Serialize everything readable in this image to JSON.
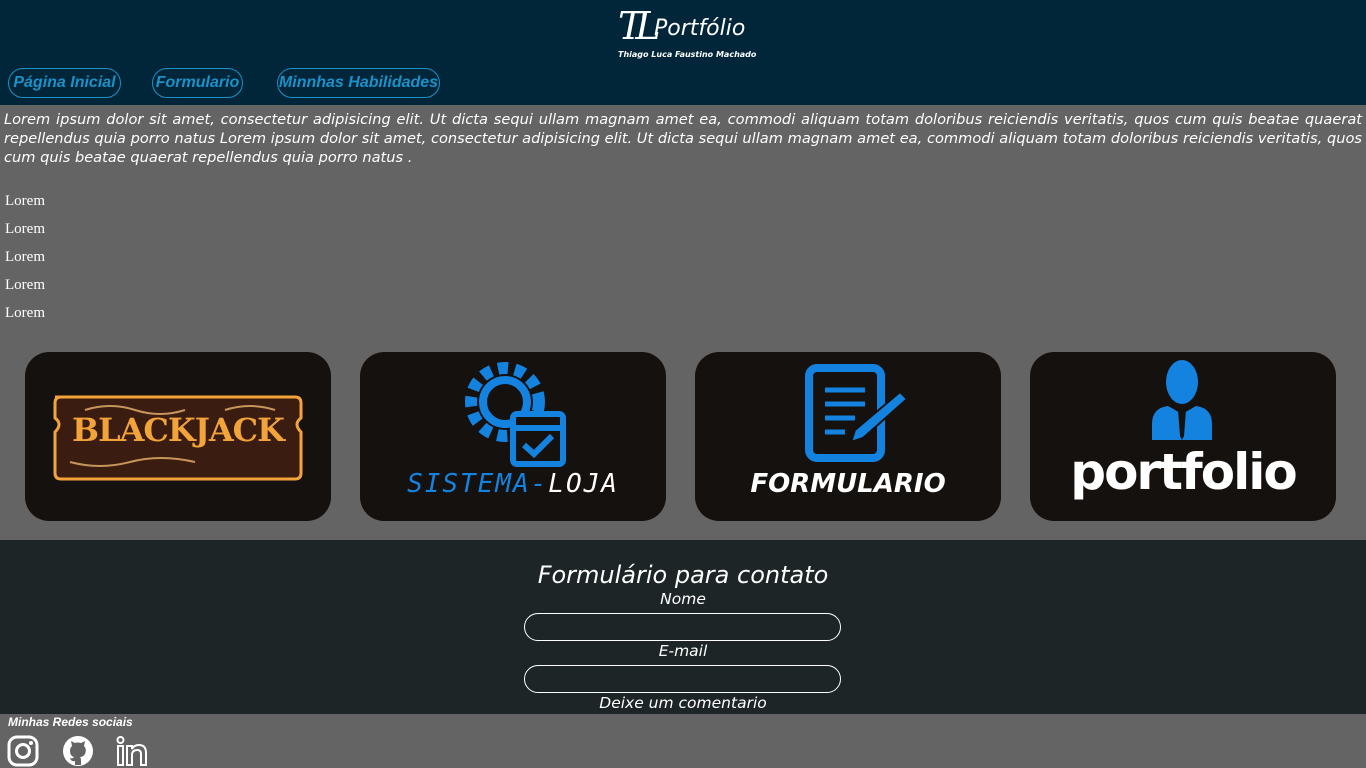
{
  "header": {
    "logo_monogram": "TL",
    "logo_word": "Portfólio",
    "logo_subtitle": "Thiago Luca Faustino Machado",
    "nav": [
      {
        "label": "Página Inicial"
      },
      {
        "label": "Formulario"
      },
      {
        "label": "Minnhas Habilidades"
      }
    ],
    "background_color": "#012539",
    "accent_color": "#1a92c9"
  },
  "intro": {
    "text": "Lorem ipsum dolor sit amet, consectetur adipisicing elit. Ut dicta sequi ullam magnam amet ea, commodi aliquam totam doloribus reiciendis veritatis, quos cum quis beatae quaerat repellendus quia porro natus Lorem ipsum dolor sit amet, consectetur adipisicing elit. Ut dicta sequi ullam magnam amet ea, commodi aliquam totam doloribus reiciendis veritatis, quos cum quis beatae quaerat repellendus quia porro natus .",
    "items": [
      "Lorem",
      "Lorem",
      "Lorem",
      "Lorem",
      "Lorem"
    ]
  },
  "projects": [
    {
      "title": "BLACKJACK",
      "icon": "blackjack-logo",
      "color": "#f2a33a"
    },
    {
      "title": "SISTEMA-LOJA",
      "title_part1": "SISTEMA-",
      "title_part2": "LOJA",
      "icon": "gear-checklist-icon",
      "color": "#1483e0"
    },
    {
      "title": "FORMULARIO",
      "icon": "document-pencil-icon",
      "color": "#1483e0"
    },
    {
      "title": "portfolio",
      "icon": "businessman-icon",
      "color": "#1483e0"
    }
  ],
  "contact": {
    "title": "Formulário para contato",
    "fields": [
      {
        "label": "Nome",
        "value": ""
      },
      {
        "label": "E-mail",
        "value": ""
      },
      {
        "label": "Deixe um comentario"
      }
    ],
    "background_color": "#1d2527"
  },
  "footer": {
    "social_title": "Minhas Redes sociais",
    "social": [
      {
        "icon": "instagram-icon"
      },
      {
        "icon": "github-icon"
      },
      {
        "icon": "linkedin-icon"
      }
    ]
  }
}
